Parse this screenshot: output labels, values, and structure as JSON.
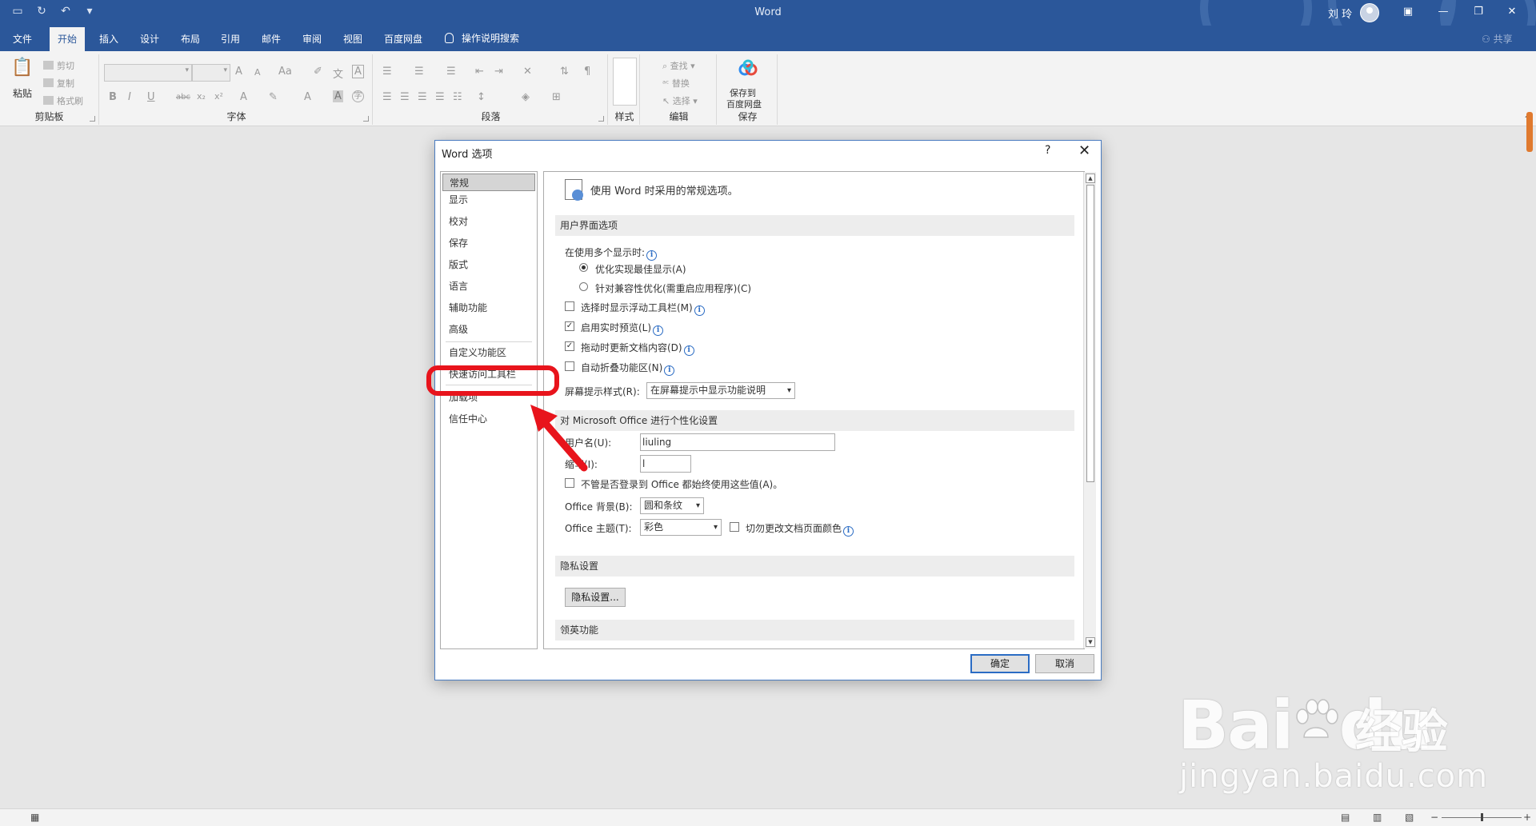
{
  "app": {
    "title": "Word",
    "user_name": "刘 玲"
  },
  "tabs": [
    "文件",
    "开始",
    "插入",
    "设计",
    "布局",
    "引用",
    "邮件",
    "审阅",
    "视图",
    "百度网盘"
  ],
  "tell_me": "操作说明搜索",
  "share": "共享",
  "ribbon": {
    "clipboard": {
      "paste": "粘贴",
      "cut": "剪切",
      "copy": "复制",
      "format_painter": "格式刷",
      "label": "剪贴板"
    },
    "font": {
      "label": "字体",
      "bold": "B",
      "italic": "I",
      "underline": "U",
      "strike": "abc",
      "sub": "x₂",
      "sup": "x²",
      "grow": "A",
      "shrink": "A",
      "case": "Aa"
    },
    "paragraph": {
      "label": "段落"
    },
    "styles": {
      "label": "样式"
    },
    "editing": {
      "label": "编辑",
      "find": "查找",
      "replace": "替换",
      "select": "选择"
    },
    "save": {
      "line1": "保存到",
      "line2": "百度网盘",
      "label": "保存"
    }
  },
  "dialog": {
    "title": "Word 选项",
    "help": "?",
    "close": "✕",
    "nav": [
      "常规",
      "显示",
      "校对",
      "保存",
      "版式",
      "语言",
      "辅助功能",
      "高级",
      "自定义功能区",
      "快速访问工具栏",
      "加载项",
      "信任中心"
    ],
    "heading": "使用 Word 时采用的常规选项。",
    "sections": {
      "ui": "用户界面选项",
      "personalize": "对 Microsoft Office 进行个性化设置",
      "privacy": "隐私设置",
      "linkedin": "领英功能"
    },
    "multi_display_label": "在使用多个显示时:",
    "radio_optimize": "优化实现最佳显示(A)",
    "radio_compat": "针对兼容性优化(需重启应用程序)(C)",
    "chk_minitoolbar": "选择时显示浮动工具栏(M)",
    "chk_livepreview": "启用实时预览(L)",
    "chk_update_drag": "拖动时更新文档内容(D)",
    "chk_collapse": "自动折叠功能区(N)",
    "screentip_label": "屏幕提示样式(R):",
    "screentip_value": "在屏幕提示中显示功能说明",
    "username_label": "用户名(U):",
    "username_value": "liuling",
    "initials_label": "缩写(I):",
    "initials_value": "l",
    "chk_always_use": "不管是否登录到 Office 都始终使用这些值(A)。",
    "background_label": "Office 背景(B):",
    "background_value": "圆和条纹",
    "theme_label": "Office 主题(T):",
    "theme_value": "彩色",
    "chk_never_change_page_color": "切勿更改文档页面颜色",
    "privacy_button": "隐私设置...",
    "ok": "确定",
    "cancel": "取消"
  },
  "checks": {
    "minitoolbar": false,
    "livepreview": true,
    "update_drag": true,
    "collapse": false,
    "always_use": false,
    "never_change_page_color": false
  },
  "radio_selected": "optimize",
  "annotation": {
    "target": "快速访问工具栏",
    "color": "#e8141c"
  },
  "colors": {
    "word_blue": "#2b579a",
    "accent_red": "#e8141c"
  },
  "watermark": {
    "brand": "Bai",
    "brand2": "du",
    "cn": "经验",
    "url": "jingyan.baidu.com"
  }
}
